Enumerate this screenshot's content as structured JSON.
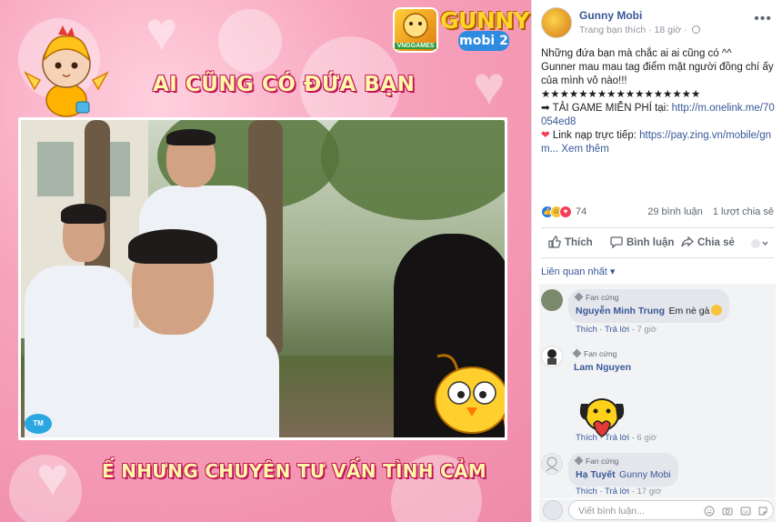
{
  "media": {
    "top_caption": "AI CŨNG CÓ ĐỨA BẠN",
    "bottom_caption": "Ế NHƯNG CHUYÊN TƯ VẤN TÌNH CẢM",
    "logo_small_text": "VNGGAMES",
    "logo_main_text": "GUNNY",
    "logo_sub_text": "mobi 2",
    "watermark_text": "TM"
  },
  "post": {
    "page_name": "Gunny Mobi",
    "meta_prefix": "Trang bạn thích",
    "meta_time": "18 giờ",
    "body_line1": "Những đứa bạn mà chắc ai ai cũng có ^^",
    "body_line2": "Gunner mau mau tag điểm mặt người đồng chí ấy của mình vô nào!!!",
    "stars": "★★★★★★★★★★★★★★★★★",
    "download_prefix": "➡ TẢI GAME MIỄN PHÍ tại: ",
    "download_link": "http://m.onelink.me/70054ed8",
    "topup_prefix": " Link nạp trực tiếp: ",
    "topup_link": "https://pay.zing.vn/mobile/gnm...",
    "see_more": "Xem thêm",
    "reaction_count": "74",
    "comments_count": "29 bình luận",
    "shares_count": "1 lượt chia sẻ",
    "action_like": "Thích",
    "action_comment": "Bình luận",
    "action_share": "Chia sẻ",
    "sort_label": "Liên quan nhất"
  },
  "comments": [
    {
      "badge": "Fan cứng",
      "name": "Nguyễn Minh Trung",
      "text": "Em nè gà",
      "like": "Thích",
      "reply": "Trả lời",
      "time": "7 giờ"
    },
    {
      "badge": "Fan cứng",
      "name": "Lam Nguyen",
      "text": "",
      "like": "Thích",
      "reply": "Trả lời",
      "time": "6 giờ"
    },
    {
      "badge": "Fan cứng",
      "name": "Hạ Tuyết",
      "text": "Gunny Mobi",
      "like": "Thích",
      "reply": "Trả lời",
      "time": "17 giờ"
    }
  ],
  "composer": {
    "placeholder": "Viết bình luận..."
  },
  "colors": {
    "link": "#385898",
    "meta": "#90949c",
    "caption": "#fff8a8",
    "caption_outline": "#c2185b"
  },
  "icons": [
    "globe-icon",
    "more-icon",
    "like-icon",
    "comment-icon",
    "share-icon",
    "emoji-icon",
    "camera-icon",
    "gif-icon",
    "sticker-icon"
  ]
}
